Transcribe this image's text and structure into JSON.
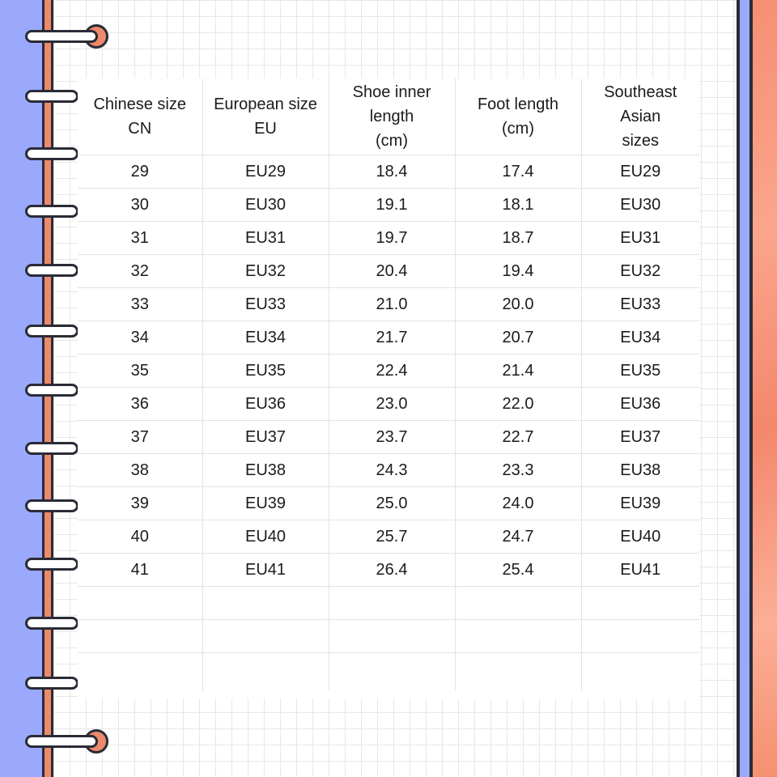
{
  "table": {
    "headers": [
      [
        "Chinese size",
        "CN"
      ],
      [
        "European size",
        "EU"
      ],
      [
        "Shoe inner",
        "length",
        "(cm)"
      ],
      [
        "Foot length",
        "(cm)"
      ],
      [
        "Southeast",
        "Asian",
        "sizes"
      ]
    ],
    "rows": [
      [
        "29",
        "EU29",
        "18.4",
        "17.4",
        "EU29"
      ],
      [
        "30",
        "EU30",
        "19.1",
        "18.1",
        "EU30"
      ],
      [
        "31",
        "EU31",
        "19.7",
        "18.7",
        "EU31"
      ],
      [
        "32",
        "EU32",
        "20.4",
        "19.4",
        "EU32"
      ],
      [
        "33",
        "EU33",
        "21.0",
        "20.0",
        "EU33"
      ],
      [
        "34",
        "EU34",
        "21.7",
        "20.7",
        "EU34"
      ],
      [
        "35",
        "EU35",
        "22.4",
        "21.4",
        "EU35"
      ],
      [
        "36",
        "EU36",
        "23.0",
        "22.0",
        "EU36"
      ],
      [
        "37",
        "EU37",
        "23.7",
        "22.7",
        "EU37"
      ],
      [
        "38",
        "EU38",
        "24.3",
        "23.3",
        "EU38"
      ],
      [
        "39",
        "EU39",
        "25.0",
        "24.0",
        "EU39"
      ],
      [
        "40",
        "EU40",
        "25.7",
        "24.7",
        "EU40"
      ],
      [
        "41",
        "EU41",
        "26.4",
        "25.4",
        "EU41"
      ]
    ]
  },
  "theme": {
    "left_band": "#9aa9fb",
    "spine": "#ec8a6b",
    "right_band": "#f58f73",
    "outline": "#2a2b36",
    "grid_line": "#e7e7ea"
  },
  "icons": [
    "binder-ring-icon"
  ]
}
